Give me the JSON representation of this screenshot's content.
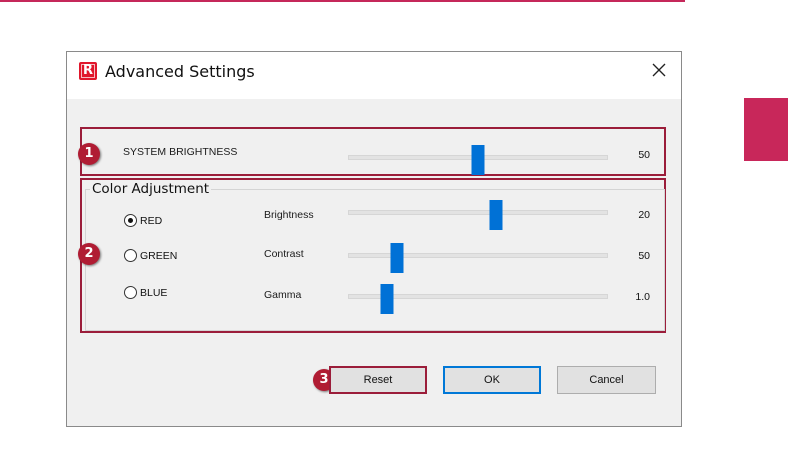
{
  "dialog": {
    "title": "Advanced Settings",
    "icon_letter": "R"
  },
  "system_brightness": {
    "label": "SYSTEM BRIGHTNESS",
    "value": "50",
    "level": 0.5
  },
  "color_adjustment": {
    "title": "Color Adjustment",
    "channels": [
      {
        "label": "RED",
        "selected": true
      },
      {
        "label": "GREEN",
        "selected": false
      },
      {
        "label": "BLUE",
        "selected": false
      }
    ],
    "sliders": [
      {
        "label": "Brightness",
        "value": "20",
        "level": 0.57
      },
      {
        "label": "Contrast",
        "value": "50",
        "level": 0.19
      },
      {
        "label": "Gamma",
        "value": "1.0",
        "level": 0.15
      }
    ]
  },
  "buttons": {
    "reset": "Reset",
    "ok": "OK",
    "cancel": "Cancel"
  },
  "callouts": [
    "1",
    "2",
    "3"
  ],
  "colors": {
    "accent": "#c8275a",
    "callout": "#b01c33",
    "slider_thumb": "#0071d6",
    "default_button_border": "#0078d7"
  }
}
